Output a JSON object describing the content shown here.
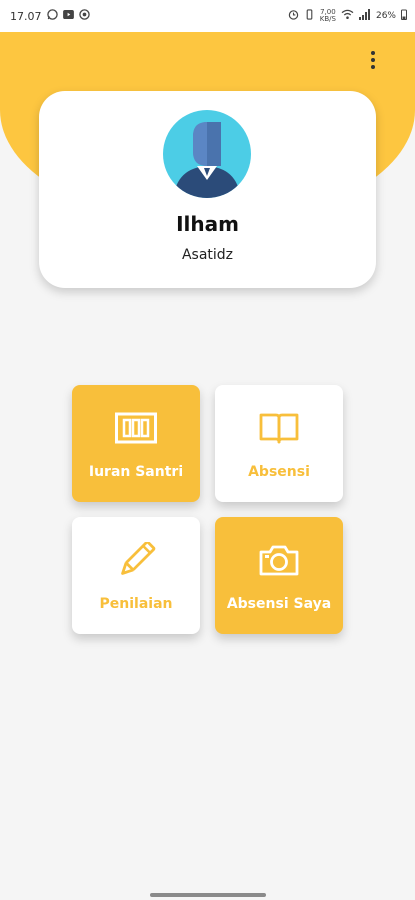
{
  "status_bar": {
    "time": "17.07",
    "left_icons": [
      "whatsapp-icon",
      "youtube-icon",
      "sync-icon"
    ],
    "right_icons": [
      "alarm-icon",
      "vibrate-icon",
      "data-speed-icon",
      "wifi-icon",
      "signal-icon"
    ],
    "data_speed": "7,00\nKB/S",
    "battery": "26%"
  },
  "header": {
    "menu_icon": "more-vert-icon",
    "accent_color": "#fdc640"
  },
  "profile": {
    "name": "Ilham",
    "role": "Asatidz",
    "avatar_icon": "user-avatar-icon"
  },
  "menu": {
    "items": [
      {
        "label": "Iuran Santri",
        "icon": "wallet-icon",
        "style": "yellow"
      },
      {
        "label": "Absensi",
        "icon": "book-icon",
        "style": "white"
      },
      {
        "label": "Penilaian",
        "icon": "pencil-icon",
        "style": "white"
      },
      {
        "label": "Absensi Saya",
        "icon": "camera-icon",
        "style": "yellow"
      }
    ]
  }
}
